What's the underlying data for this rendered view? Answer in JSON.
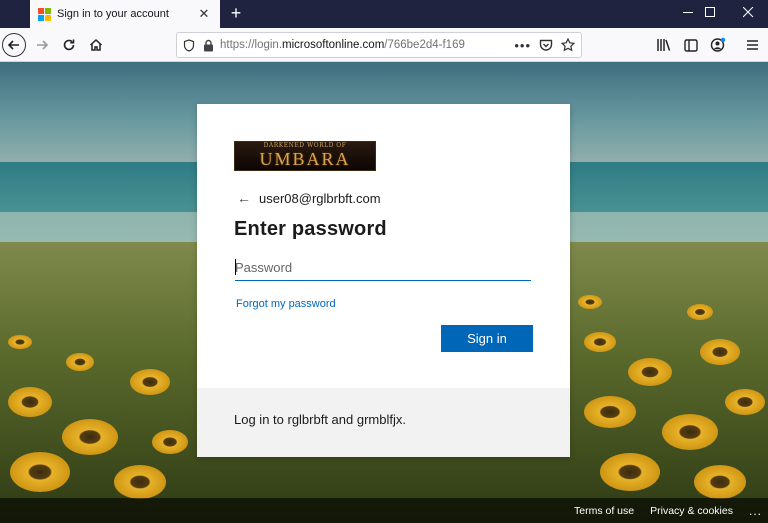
{
  "browser": {
    "tab_title": "Sign in to your account",
    "new_tab_label": "+",
    "url_prefix": "https://login.",
    "url_domain": "microsoftonline.com",
    "url_rest": "/766be2d4-f169",
    "ms_colors": [
      "#f25022",
      "#7fba00",
      "#00a4ef",
      "#ffb900"
    ]
  },
  "card": {
    "brand_top": "DARKENED WORLD OF",
    "brand_main": "UMBARA",
    "email": "user08@rglbrbft.com",
    "heading": "Enter password",
    "password_placeholder": "Password",
    "forgot_link": "Forgot my password",
    "signin_label": "Sign in",
    "footer_message": "Log in to rglbrbft and grmblfjx."
  },
  "footer": {
    "terms": "Terms of use",
    "privacy": "Privacy & cookies",
    "more": "..."
  },
  "colors": {
    "accent": "#0067b8",
    "tabbar": "#202340"
  }
}
